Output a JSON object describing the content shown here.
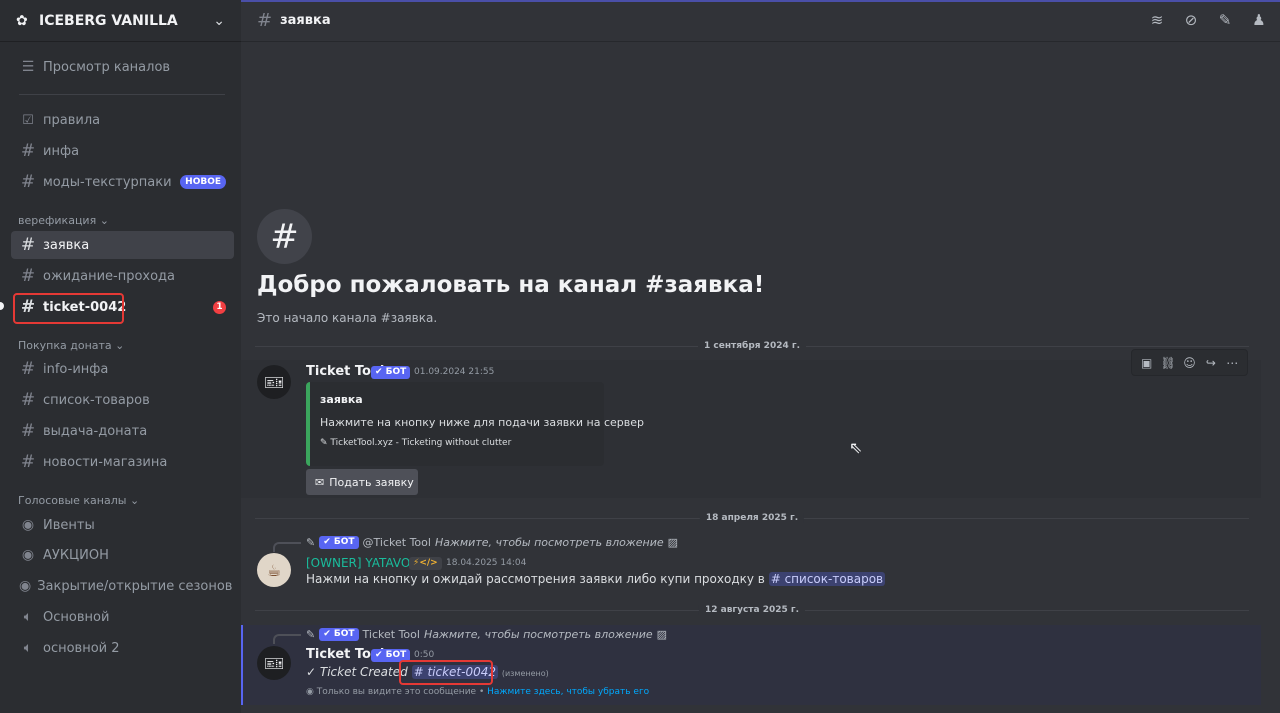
{
  "server": {
    "name": "ICEBERG VANILLA"
  },
  "sidebar": {
    "browse_channels": "Просмотр каналов",
    "top_channels": [
      {
        "label": "правила",
        "icon": "rules-icon"
      },
      {
        "label": "инфа",
        "icon": "hash-icon"
      },
      {
        "label": "моды-текстурпаки",
        "icon": "hash-icon",
        "badge": "НОВОЕ"
      }
    ],
    "categories": {
      "verification": "верефикация",
      "donate": "Покупка доната",
      "voice": "Голосовые каналы"
    },
    "verification_channels": [
      {
        "label": "заявка"
      },
      {
        "label": "ожидание-прохода"
      },
      {
        "label": "ticket-0042",
        "badge": "1"
      }
    ],
    "donate_channels": [
      {
        "label": "info-инфа"
      },
      {
        "label": "список-товаров"
      },
      {
        "label": "выдача-доната"
      },
      {
        "label": "новости-магазина"
      }
    ],
    "voice_channels": [
      {
        "label": "Ивенты",
        "icon": "stage-icon"
      },
      {
        "label": "АУКЦИОН",
        "icon": "stage-icon"
      },
      {
        "label": "Закрытие/открытие сезонов",
        "icon": "stage-icon"
      },
      {
        "label": "Основной",
        "icon": "speaker-icon"
      },
      {
        "label": "основной 2",
        "icon": "speaker-icon"
      }
    ]
  },
  "header": {
    "channel": "заявка"
  },
  "welcome": {
    "title": "Добро пожаловать на канал #заявка!",
    "subtitle": "Это начало канала #заявка."
  },
  "dates": {
    "d1": "1 сентября 2024 г.",
    "d2": "18 апреля 2025 г.",
    "d3": "12 августа 2025 г."
  },
  "messages": {
    "m1": {
      "author": "Ticket Tool",
      "bot_tag": "✔ БОТ",
      "time": "01.09.2024 21:55",
      "embed_title": "заявка",
      "embed_desc": "Нажмите на кнопку ниже для подачи заявки на сервер",
      "embed_footer": "TicketTool.xyz - Ticketing without clutter",
      "button": "Подать заявку"
    },
    "m2": {
      "reply_bot": "✔ БОТ",
      "reply_author": "@Ticket Tool",
      "reply_text": "Нажмите, чтобы посмотреть вложение",
      "author": "[OWNER] YATAVO",
      "author_tag": "⚡</>",
      "time": "18.04.2025 14:04",
      "text": "Нажми на кнопку и ожидай рассмотрения заявки либо купи проходку в",
      "mention": "# список-товаров"
    },
    "m3": {
      "reply_bot": "✔ БОТ",
      "reply_author": "Ticket Tool",
      "reply_text": "Нажмите, чтобы посмотреть вложение",
      "author": "Ticket Tool",
      "bot_tag": "✔ БОТ",
      "time": "0:50",
      "text": "✓ Ticket Created",
      "mention": "# ticket-0042",
      "edited": "(изменено)",
      "ephemeral": "Только вы видите это сообщение •",
      "dismiss": "Нажмите здесь, чтобы убрать его"
    }
  }
}
